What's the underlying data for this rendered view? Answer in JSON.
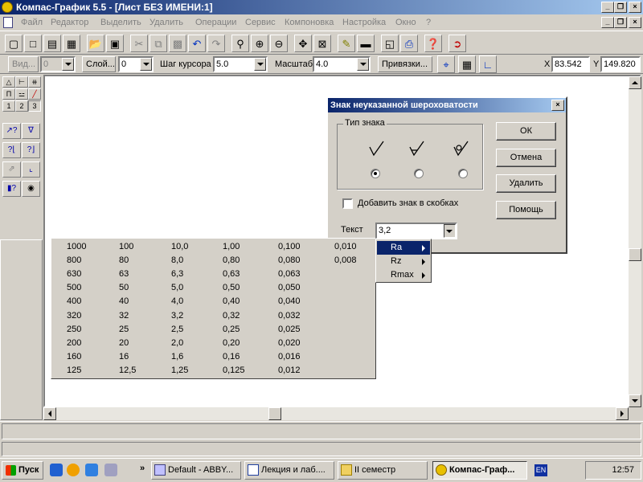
{
  "window": {
    "title": "Компас-График 5.5 - [Лист БЕЗ ИМЕНИ:1]",
    "minimize": "_",
    "maximize": "❐",
    "close": "×"
  },
  "menu": {
    "items": [
      "Файл",
      "Редактор",
      "Выделить",
      "Удалить",
      "Операции",
      "Сервис",
      "Компоновка",
      "Настройка",
      "Окно",
      "?"
    ]
  },
  "params": {
    "view_button": "Вид...",
    "view_value": "0",
    "layer_button": "Слой...",
    "layer_value": "0",
    "cursor_step_label": "Шаг курсора",
    "cursor_step_value": "5.0",
    "scale_label": "Масштаб",
    "scale_value": "4.0",
    "snaps_button": "Привязки...",
    "x_label": "X",
    "x_value": "83.542",
    "y_label": "Y",
    "y_value": "149.820"
  },
  "left_panel": {
    "row3": [
      "1",
      "2",
      "3"
    ]
  },
  "dialog": {
    "title": "Знак неуказанной шероховатости",
    "group_label": "Тип знака",
    "ok": "ОК",
    "cancel": "Отмена",
    "delete": "Удалить",
    "help": "Помощь",
    "bracket_checkbox_label": "Добавить знак в скобках",
    "bracket_checked": false,
    "text_label": "Текст",
    "text_value": "3,2",
    "selected_type": 0
  },
  "values_table": {
    "rows": [
      [
        "1000",
        "100",
        "10,0",
        "1,00",
        "0,100",
        "0,010"
      ],
      [
        "800",
        "80",
        "8,0",
        "0,80",
        "0,080",
        "0,008"
      ],
      [
        "630",
        "63",
        "6,3",
        "0,63",
        "0,063",
        ""
      ],
      [
        "500",
        "50",
        "5,0",
        "0,50",
        "0,050",
        ""
      ],
      [
        "400",
        "40",
        "4,0",
        "0,40",
        "0,040",
        ""
      ],
      [
        "320",
        "32",
        "3,2",
        "0,32",
        "0,032",
        ""
      ],
      [
        "250",
        "25",
        "2,5",
        "0,25",
        "0,025",
        ""
      ],
      [
        "200",
        "20",
        "2,0",
        "0,20",
        "0,020",
        ""
      ],
      [
        "160",
        "16",
        "1,6",
        "0,16",
        "0,016",
        ""
      ],
      [
        "125",
        "12,5",
        "1,25",
        "0,125",
        "0,012",
        ""
      ]
    ]
  },
  "submenu": {
    "items": [
      "Ra",
      "Rz",
      "Rmax"
    ],
    "selected": 0
  },
  "taskbar": {
    "start": "Пуск",
    "tasks": [
      "Default - ABBY...",
      "Лекция и лаб....",
      "II семестр",
      "Компас-Граф..."
    ],
    "active_task": 3,
    "lang": "EN",
    "clock": "12:57"
  },
  "colors": {
    "titlebar_start": "#0a246a",
    "titlebar_end": "#a6caf0",
    "face": "#d4d0c8",
    "highlight": "#0a246a"
  },
  "icons": [
    "new-sheet-icon",
    "new-fragment-icon",
    "new-text-icon",
    "new-spec-icon",
    "open-icon",
    "save-icon",
    "cut-icon",
    "copy-icon",
    "paste-icon",
    "undo-icon",
    "redo-icon",
    "zoom-icon",
    "zoom-in-icon",
    "zoom-out-icon",
    "pan-icon",
    "zoom-fit-icon",
    "properties-icon",
    "layer-icon",
    "print-preview-icon",
    "print-icon",
    "help-pointer-icon",
    "exit-icon"
  ]
}
